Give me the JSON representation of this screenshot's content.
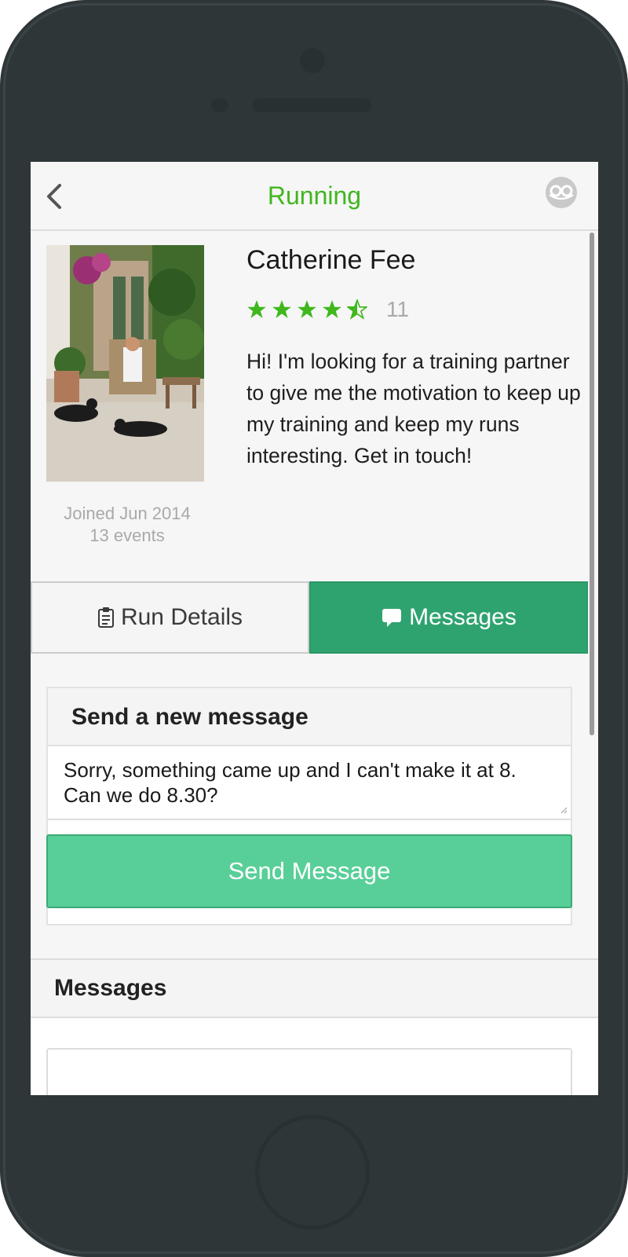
{
  "header": {
    "title": "Running",
    "back_icon": "chevron-left-icon",
    "logo_icon": "app-logo-icon"
  },
  "profile": {
    "name": "Catherine Fee",
    "rating_stars": 4.5,
    "rating_max": 5,
    "rating_count": "11",
    "bio": "Hi! I'm looking for a training partner to give me the motivation to keep up my training and keep my runs interesting. Get in touch!",
    "joined": "Joined Jun 2014",
    "events": "13 events"
  },
  "tabs": [
    {
      "label": "Run Details",
      "icon": "clipboard-icon",
      "active": false
    },
    {
      "label": "Messages",
      "icon": "speech-bubble-icon",
      "active": true
    }
  ],
  "send_card": {
    "title": "Send a new message",
    "message_value": "Sorry, something came up and I can't make it at 8. Can we do 8.30?",
    "send_label": "Send Message"
  },
  "messages_section": {
    "title": "Messages"
  },
  "colors": {
    "accent_green": "#3fb71d",
    "tab_active": "#2fa36f",
    "button_green": "#58cf98",
    "phone_body": "#2e3638"
  }
}
